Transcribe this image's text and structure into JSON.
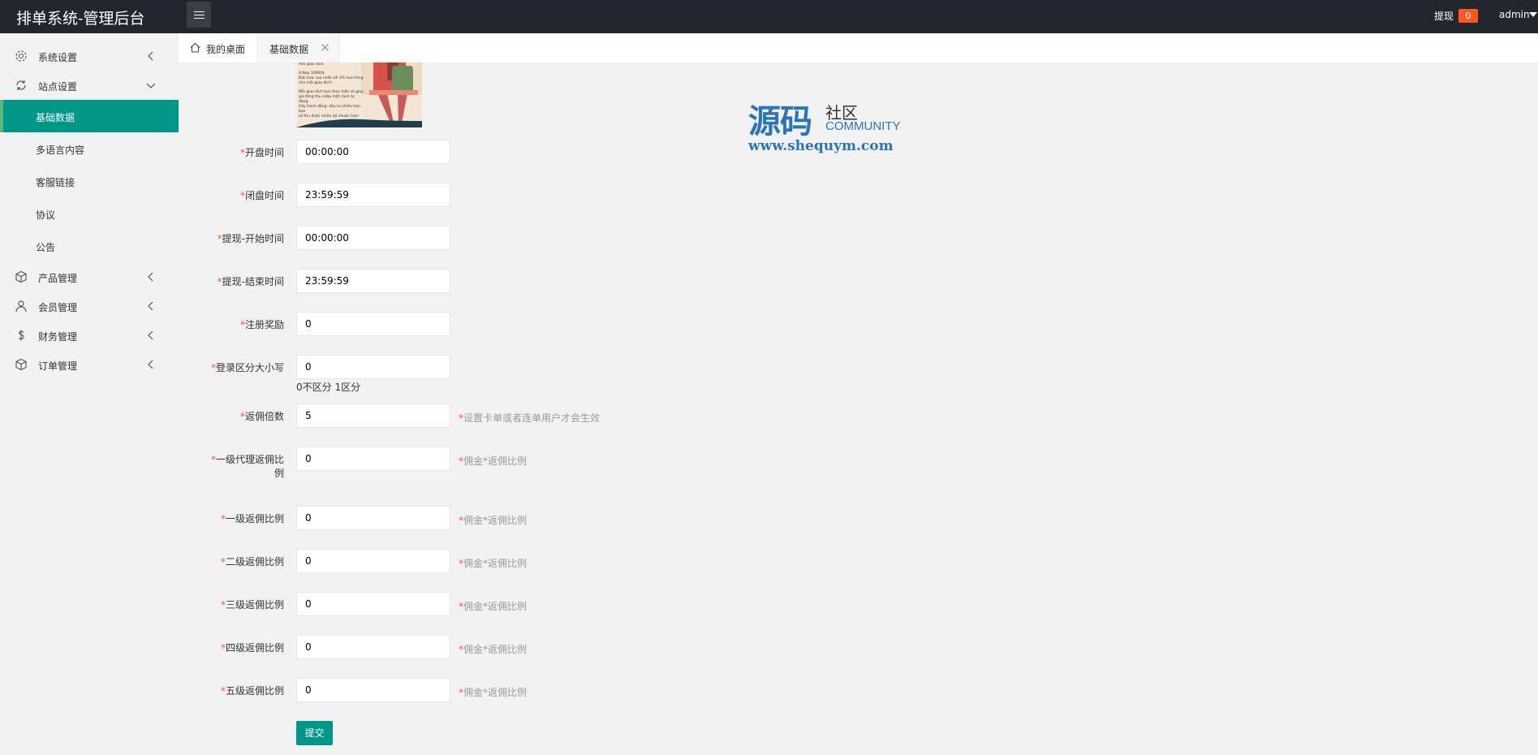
{
  "header": {
    "title": "排单系统-管理后台",
    "withdraw_label": "提现",
    "withdraw_count": "0",
    "user": "admin"
  },
  "sidebar": {
    "groups": [
      {
        "label": "系统设置",
        "icon": "gear-icon"
      },
      {
        "label": "站点设置",
        "icon": "site-icon"
      },
      {
        "label": "产品管理",
        "icon": "cube-icon"
      },
      {
        "label": "会员管理",
        "icon": "user-icon"
      },
      {
        "label": "财务管理",
        "icon": "dollar-icon"
      },
      {
        "label": "订单管理",
        "icon": "cube-icon"
      }
    ],
    "site_children": [
      {
        "label": "基础数据",
        "active": true
      },
      {
        "label": "多语言内容"
      },
      {
        "label": "客服链接"
      },
      {
        "label": "协议"
      },
      {
        "label": "公告"
      }
    ]
  },
  "tabs": {
    "home": "我的桌面",
    "active": "基础数据"
  },
  "watermark": {
    "big": "源码",
    "small": "社区",
    "community": "COMMUNITY",
    "url": "www.shequym.com"
  },
  "banner_text": [
    "mỗi giao dịch.",
    "A.Nạp 10000$",
    "Đạt mức cao nhất với 3% hoa hồng",
    "cho mỗi giao dịch!",
    "Mỗi giao dịch bạn thực hiện sẽ giúp",
    "gia tăng thu nhập một cách tự động.",
    "Hãy hành động: đầu tư nhiều hơn, bạn",
    "sẽ thu được nhiều lợi nhuận hơn!"
  ],
  "form": {
    "required_mark": "*",
    "fields": [
      {
        "label": "开盘时间",
        "value": "00:00:00"
      },
      {
        "label": "闭盘时间",
        "value": "23:59:59"
      },
      {
        "label": "提现-开始时间",
        "value": "00:00:00"
      },
      {
        "label": "提现-结束时间",
        "value": "23:59:59"
      },
      {
        "label": "注册奖励",
        "value": "0"
      },
      {
        "label": "登录区分大小写",
        "value": "0",
        "aux": "0不区分 1区分"
      },
      {
        "label": "返佣倍数",
        "value": "5",
        "hint": "设置卡单或者连单用户才会生效"
      },
      {
        "label_line1": "一级代理返佣比",
        "label_line2": "例",
        "value": "0",
        "hint": "佣金*返佣比例"
      },
      {
        "label": "一级返佣比例",
        "value": "0",
        "hint": "佣金*返佣比例"
      },
      {
        "label": "二级返佣比例",
        "value": "0",
        "hint": "佣金*返佣比例"
      },
      {
        "label": "三级返佣比例",
        "value": "0",
        "hint": "佣金*返佣比例"
      },
      {
        "label": "四级返佣比例",
        "value": "0",
        "hint": "佣金*返佣比例"
      },
      {
        "label": "五级返佣比例",
        "value": "0",
        "hint": "佣金*返佣比例"
      }
    ],
    "submit": "提交"
  }
}
